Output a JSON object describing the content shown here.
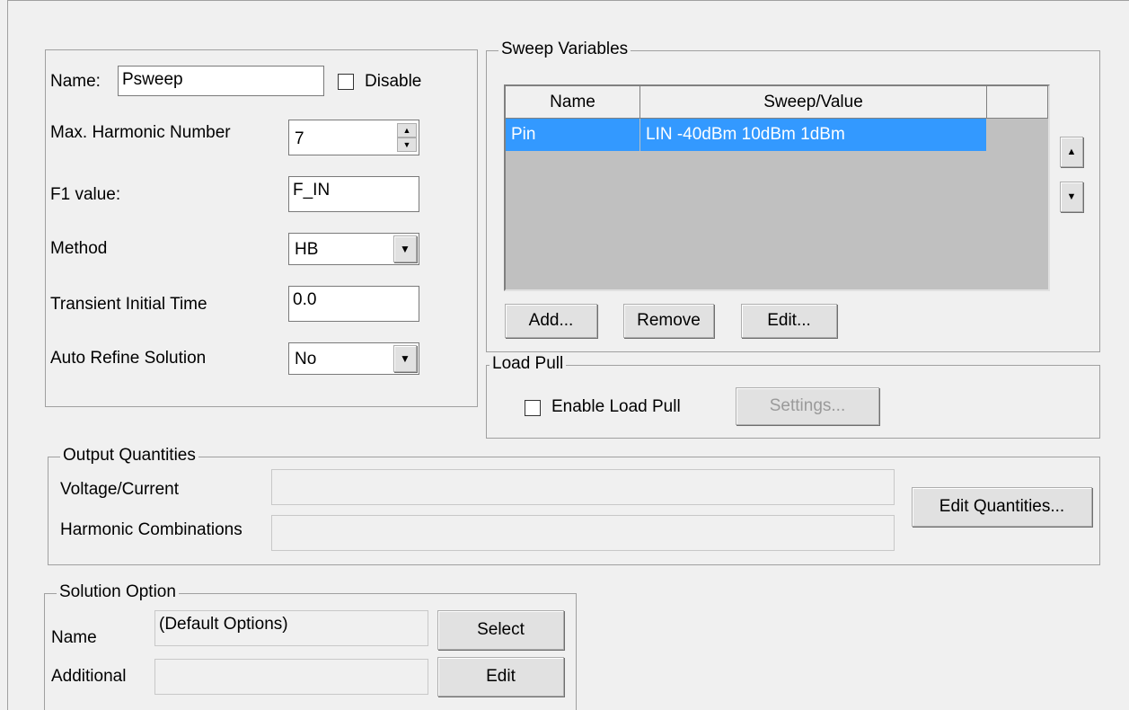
{
  "params": {
    "name_label": "Name:",
    "name_value": "Psweep",
    "disable_label": "Disable",
    "max_harmonic_label": "Max. Harmonic Number",
    "max_harmonic_value": "7",
    "f1_label": "F1 value:",
    "f1_value": "F_IN",
    "method_label": "Method",
    "method_value": "HB",
    "transient_label": "Transient Initial Time",
    "transient_value": "0.0",
    "auto_refine_label": "Auto Refine Solution",
    "auto_refine_value": "No"
  },
  "sweep": {
    "title": "Sweep Variables",
    "columns": [
      "Name",
      "Sweep/Value"
    ],
    "rows": [
      {
        "name": "Pin",
        "value": "LIN -40dBm 10dBm 1dBm"
      }
    ],
    "add_label": "Add...",
    "remove_label": "Remove",
    "edit_label": "Edit..."
  },
  "load_pull": {
    "title": "Load Pull",
    "enable_label": "Enable Load Pull",
    "settings_label": "Settings..."
  },
  "output": {
    "title": "Output Quantities",
    "voltage_label": "Voltage/Current",
    "harmonic_label": "Harmonic Combinations",
    "edit_quantities_label": "Edit Quantities..."
  },
  "solution": {
    "title": "Solution Option",
    "name_label": "Name",
    "name_value": "(Default Options)",
    "select_label": "Select",
    "additional_label": "Additional",
    "edit_label": "Edit"
  }
}
